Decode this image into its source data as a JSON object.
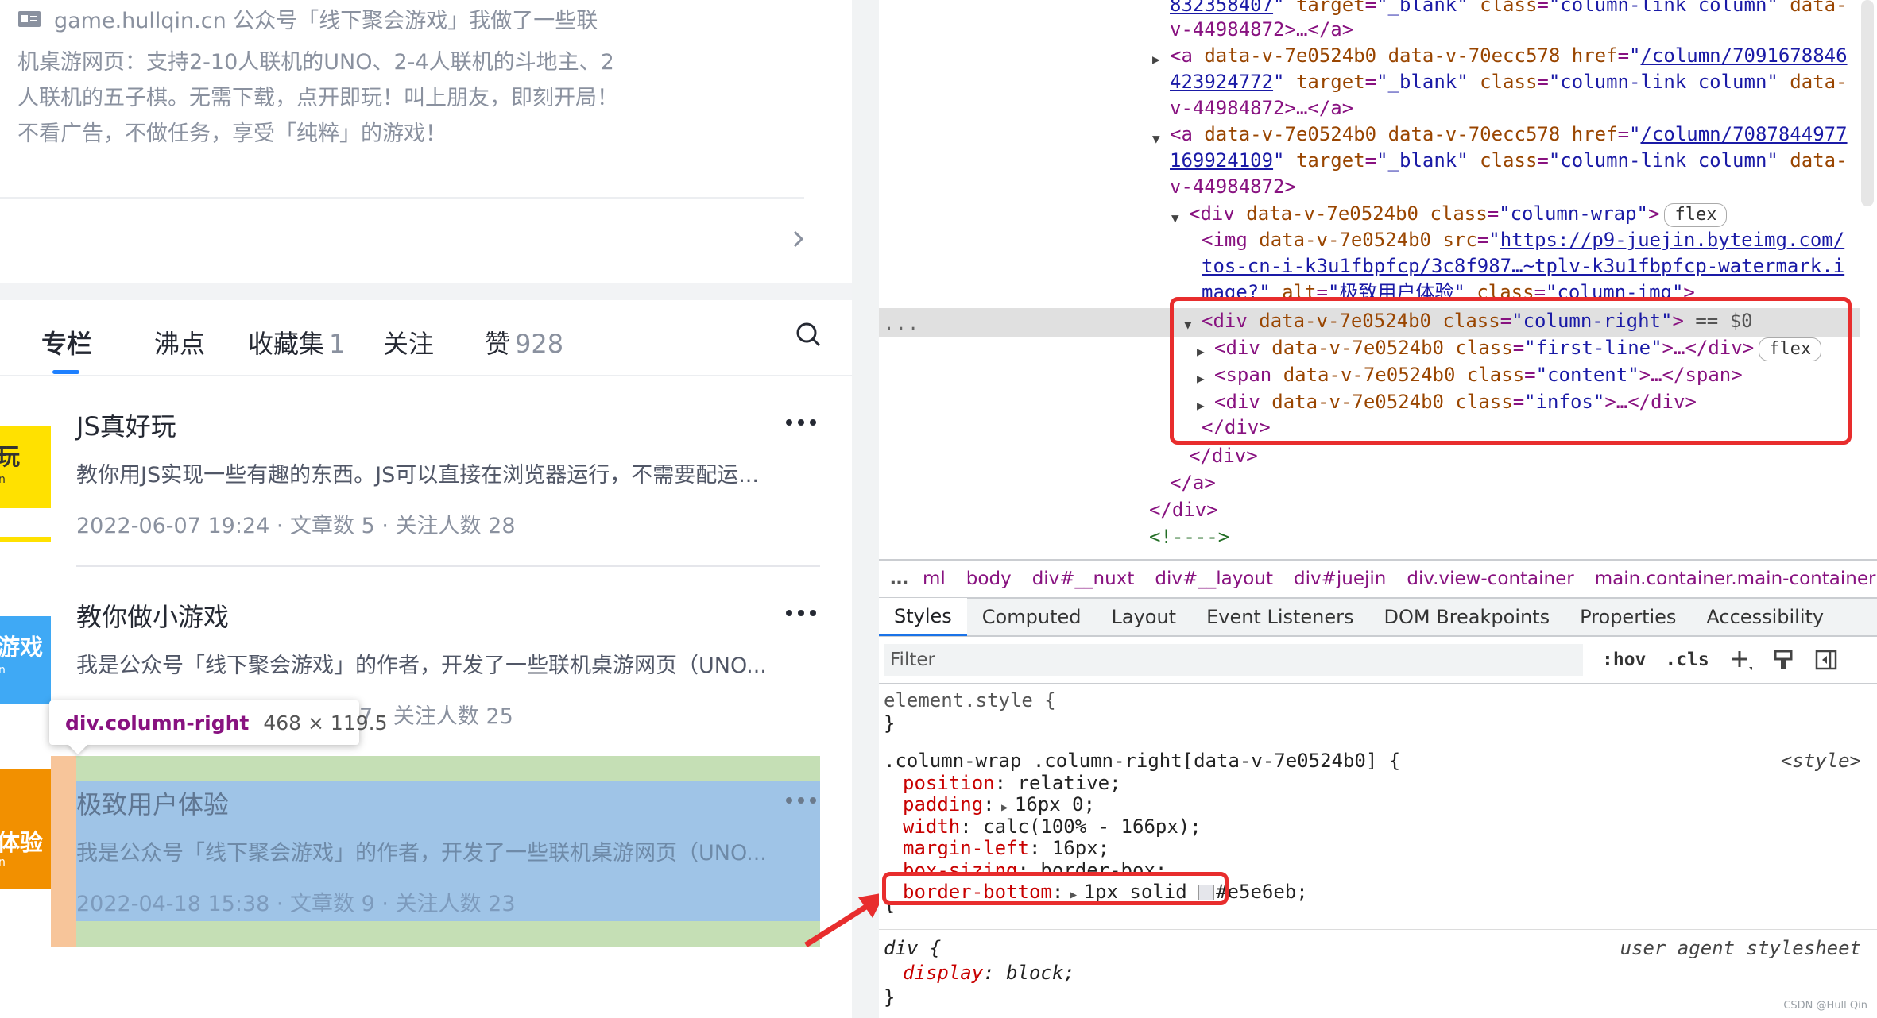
{
  "left": {
    "promo": {
      "line1": "game.hullqin.cn 公众号「线下聚会游戏」我做了一些联",
      "body": "机桌游网页：支持2-10人联机的UNO、2-4人联机的斗地主、2人联机的五子棋。无需下载，点开即玩！叫上朋友，即刻开局！不看广告，不做任务，享受「纯粹」的游戏！"
    },
    "tabs": [
      {
        "label": "专栏",
        "count": ""
      },
      {
        "label": "沸点",
        "count": ""
      },
      {
        "label": "收藏集",
        "count": "1"
      },
      {
        "label": "关注",
        "count": ""
      },
      {
        "label": "赞",
        "count": "928"
      }
    ],
    "columns": [
      {
        "thumb_text": "玩",
        "thumb_sub": "n",
        "title": "JS真好玩",
        "desc": "教你用JS实现一些有趣的东西。JS可以直接在浏览器运行，不需要配运...",
        "meta": "2022-06-07 19:24 · 文章数 5 · 关注人数 28"
      },
      {
        "thumb_text": "游戏",
        "thumb_sub": "n",
        "title": "教你做小游戏",
        "desc": "我是公众号「线下聚会游戏」的作者，开发了一些联机桌游网页（UNO...",
        "meta": "7 · 关注人数 25"
      },
      {
        "thumb_text": "体验",
        "thumb_sub": "n",
        "title": "极致用户体验",
        "desc": "我是公众号「线下聚会游戏」的作者，开发了一些联机桌游网页（UNO...",
        "meta": "2022-04-18 15:38 · 文章数 9 · 关注人数 23"
      }
    ],
    "tooltip": {
      "selector": "div.column-right",
      "size": "468 × 119.5"
    }
  },
  "devtools": {
    "breadcrumb": [
      "…",
      "ml",
      "body",
      "div#__nuxt",
      "div#__layout",
      "div#juejin",
      "div.view-container",
      "main.container.main-container"
    ],
    "breadcrumb_more": "…",
    "tabs": [
      "Styles",
      "Computed",
      "Layout",
      "Event Listeners",
      "DOM Breakpoints",
      "Properties",
      "Accessibility"
    ],
    "filter_placeholder": "Filter",
    "filter_tools": [
      ":hov",
      ".cls"
    ],
    "watermark": "CSDN @Hull Qin",
    "dom_badges": {
      "flex": "flex",
      "eq": "== $0"
    },
    "source_style": "<style>",
    "source_ua": "user agent stylesheet"
  },
  "colors": {
    "accent": "#1e80ff",
    "highlight_red": "#e82d2d",
    "border": "#e5e6eb"
  }
}
